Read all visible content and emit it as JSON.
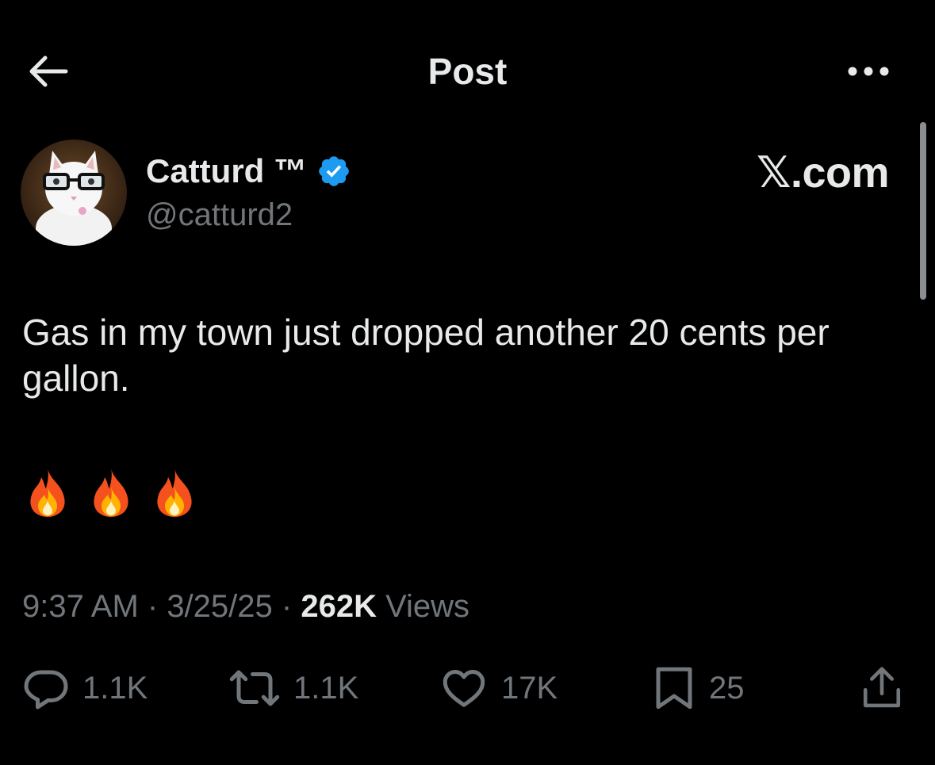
{
  "header": {
    "title": "Post",
    "back_icon": "arrow-left-icon",
    "more_icon": "more-dots-icon"
  },
  "author": {
    "display_name": "Catturd ™",
    "handle": "@catturd2",
    "verified_color": "#1d9bf0",
    "avatar": "cat-with-glasses-avatar"
  },
  "source_label": "𝕏.com",
  "tweet": {
    "text": "Gas in my town just dropped another 20 cents per gallon.",
    "emojis": [
      "🔥",
      "🔥",
      "🔥"
    ]
  },
  "meta": {
    "time": "9:37 AM",
    "separator": " · ",
    "date": "3/25/25",
    "views_count": "262K",
    "views_label": " Views"
  },
  "actions": {
    "reply": {
      "icon": "reply-icon",
      "count": "1.1K"
    },
    "repost": {
      "icon": "repost-icon",
      "count": "1.1K"
    },
    "like": {
      "icon": "heart-icon",
      "count": "17K"
    },
    "bookmark": {
      "icon": "bookmark-icon",
      "count": "25"
    },
    "share": {
      "icon": "share-icon"
    }
  },
  "colors": {
    "background": "#000000",
    "primary_text": "#e7e9ea",
    "secondary_text": "#71767b",
    "accent": "#1d9bf0"
  }
}
